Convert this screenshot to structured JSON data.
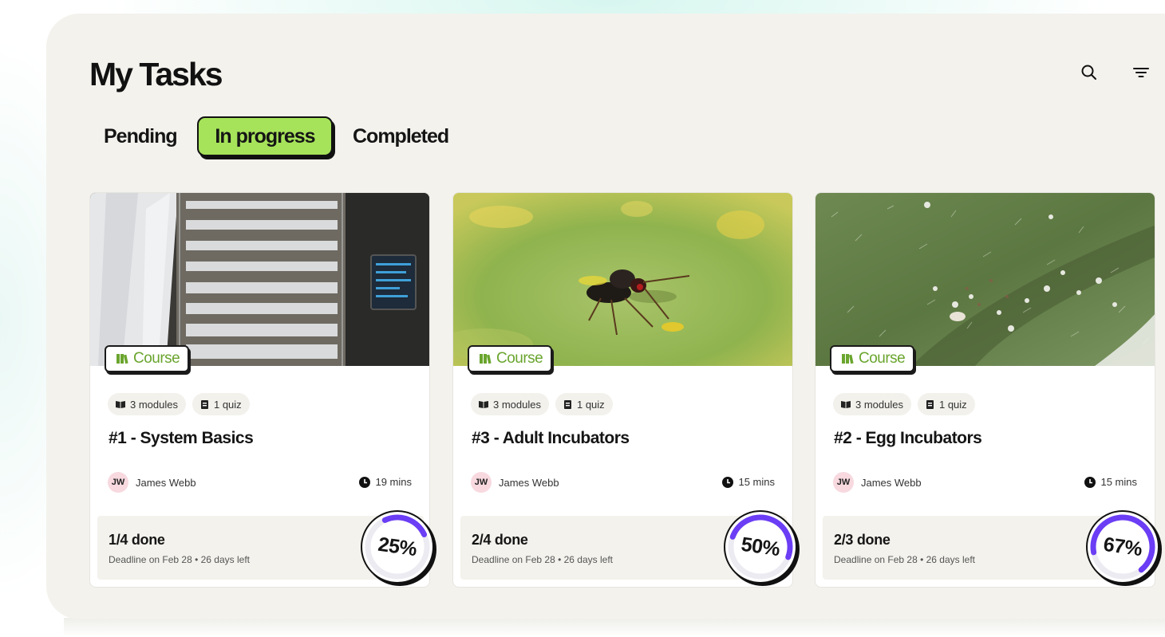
{
  "header": {
    "title": "My Tasks"
  },
  "toolbar": {
    "search_icon": "search-icon",
    "filter_icon": "filter-icon"
  },
  "tabs": [
    {
      "label": "Pending",
      "active": false
    },
    {
      "label": "In progress",
      "active": true
    },
    {
      "label": "Completed",
      "active": false
    }
  ],
  "colors": {
    "accent": "#a6e35a",
    "progress": "#6b3df5",
    "badge_text": "#6aa52e",
    "avatar_bg": "#f7d9df"
  },
  "cards": [
    {
      "badge": "Course",
      "modules": "3 modules",
      "quiz": "1 quiz",
      "title": "#1 - System Basics",
      "author_initials": "JW",
      "author": "James Webb",
      "duration": "19 mins",
      "done": "1/4 done",
      "deadline": "Deadline on Feb 28 • 26 days left",
      "progress_label": "25%",
      "progress": 0.25
    },
    {
      "badge": "Course",
      "modules": "3 modules",
      "quiz": "1 quiz",
      "title": "#3 - Adult Incubators",
      "author_initials": "JW",
      "author": "James Webb",
      "duration": "15 mins",
      "done": "2/4 done",
      "deadline": "Deadline on Feb 28 • 26 days left",
      "progress_label": "50%",
      "progress": 0.5
    },
    {
      "badge": "Course",
      "modules": "3 modules",
      "quiz": "1 quiz",
      "title": "#2 - Egg Incubators",
      "author_initials": "JW",
      "author": "James Webb",
      "duration": "15 mins",
      "done": "2/3 done",
      "deadline": "Deadline on Feb 28 • 26 days left",
      "progress_label": "67%",
      "progress": 0.67
    }
  ]
}
